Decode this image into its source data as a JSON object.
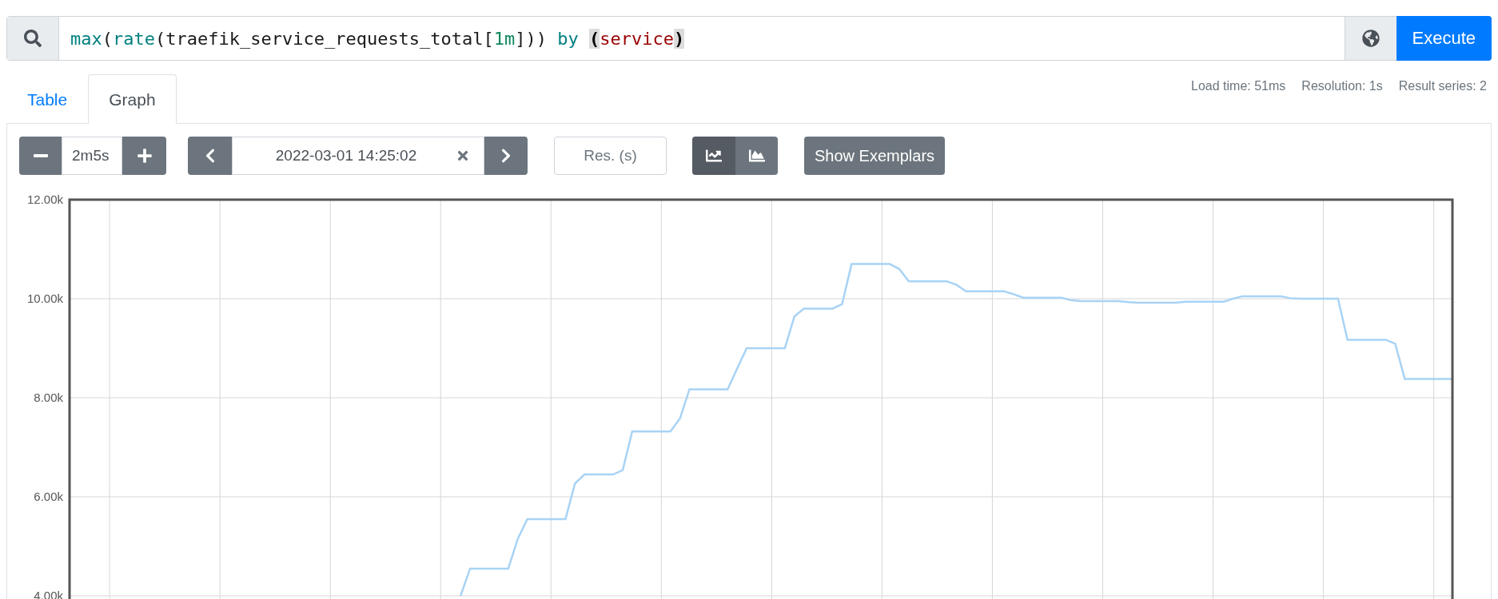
{
  "query": {
    "tokens": [
      {
        "text": "max",
        "kind": "function"
      },
      {
        "text": "(",
        "kind": "plain"
      },
      {
        "text": "rate",
        "kind": "function"
      },
      {
        "text": "(traefik_service_requests_total[",
        "kind": "plain"
      },
      {
        "text": "1m",
        "kind": "number"
      },
      {
        "text": "])) ",
        "kind": "plain"
      },
      {
        "text": "by ",
        "kind": "keyword"
      },
      {
        "text": "(",
        "kind": "matched"
      },
      {
        "text": "service",
        "kind": "label"
      },
      {
        "text": ")",
        "kind": "matched"
      }
    ]
  },
  "execute_button": "Execute",
  "tabs": [
    {
      "label": "Table",
      "selected": false
    },
    {
      "label": "Graph",
      "selected": true
    }
  ],
  "stats": [
    "Load time: 51ms",
    "Resolution: 1s",
    "Result series: 2"
  ],
  "toolbar": {
    "range": {
      "value": "2m5s"
    },
    "end_time": {
      "value": "2022-03-01 14:25:02"
    },
    "resolution": {
      "placeholder": "Res. (s)"
    },
    "chart_types": [
      {
        "kind": "line",
        "selected": true
      },
      {
        "kind": "stacked",
        "selected": false
      }
    ],
    "exemplars_button": "Show Exemplars"
  },
  "graph": {
    "chart_data": {
      "type": "line",
      "grid": true,
      "ylim": [
        4000,
        12000
      ],
      "yticks": [
        {
          "value": 4000,
          "label": "4.00k"
        },
        {
          "value": 6000,
          "label": "6.00k"
        },
        {
          "value": 8000,
          "label": "8.00k"
        },
        {
          "value": 10000,
          "label": "10.00k"
        },
        {
          "value": 12000,
          "label": "12.00k"
        }
      ],
      "categories": [
        null,
        null,
        null,
        null,
        null,
        null,
        null,
        null,
        null,
        null,
        null,
        null,
        null,
        null,
        null,
        null,
        null,
        null,
        null,
        null,
        null,
        null,
        null,
        null,
        null,
        null,
        null,
        null,
        null,
        null,
        null,
        null,
        null,
        null,
        null,
        null,
        null,
        null,
        null,
        null,
        null,
        null,
        null,
        null,
        null,
        null,
        null,
        null,
        null,
        null,
        null,
        null,
        null,
        null,
        null,
        null,
        null,
        null,
        null,
        null,
        null,
        null,
        null,
        null,
        null,
        null,
        null,
        null,
        null,
        null,
        null,
        null,
        null,
        null,
        null,
        null,
        null,
        null,
        null,
        null,
        null,
        null,
        null,
        null,
        null,
        null,
        null,
        null,
        null,
        null,
        null,
        null,
        null,
        null,
        null,
        null,
        null,
        null,
        null,
        null,
        null,
        null,
        null,
        null,
        null,
        null,
        null,
        null,
        null,
        null,
        null,
        null,
        null,
        null,
        null,
        null,
        null,
        null,
        null,
        null,
        null,
        null,
        null,
        null,
        null,
        null,
        null,
        null,
        null,
        null,
        null,
        null,
        null,
        null,
        null,
        null,
        null,
        null,
        null,
        null,
        null,
        null,
        null,
        null,
        null,
        null
      ],
      "series": [
        {
          "color": "#a8d3f5",
          "values": [
            null,
            null,
            null,
            null,
            null,
            null,
            null,
            null,
            null,
            null,
            null,
            null,
            null,
            null,
            null,
            null,
            null,
            null,
            null,
            null,
            null,
            null,
            null,
            null,
            null,
            null,
            null,
            null,
            null,
            null,
            null,
            null,
            null,
            null,
            null,
            null,
            null,
            null,
            null,
            null,
            null,
            4000,
            4550,
            4550,
            4550,
            4550,
            4550,
            5150,
            5550,
            5550,
            5550,
            5550,
            5550,
            6270,
            6450,
            6450,
            6450,
            6450,
            6540,
            7320,
            7320,
            7320,
            7320,
            7320,
            7580,
            8170,
            8170,
            8170,
            8170,
            8170,
            8590,
            9000,
            9000,
            9000,
            9000,
            9000,
            9640,
            9800,
            9800,
            9800,
            9800,
            9890,
            10700,
            10700,
            10700,
            10700,
            10700,
            10600,
            10350,
            10350,
            10350,
            10350,
            10350,
            10280,
            10150,
            10150,
            10150,
            10150,
            10150,
            10090,
            10020,
            10020,
            10020,
            10020,
            10020,
            9970,
            9950,
            9950,
            9950,
            9950,
            9950,
            9930,
            9920,
            9920,
            9920,
            9920,
            9920,
            9940,
            9940,
            9940,
            9940,
            9940,
            10000,
            10050,
            10050,
            10050,
            10050,
            10050,
            10010,
            10000,
            10000,
            10000,
            10000,
            10000,
            9170,
            9170,
            9170,
            9170,
            9170,
            9090,
            8380,
            8380,
            8380,
            8380,
            8380,
            8380
          ]
        }
      ]
    }
  }
}
